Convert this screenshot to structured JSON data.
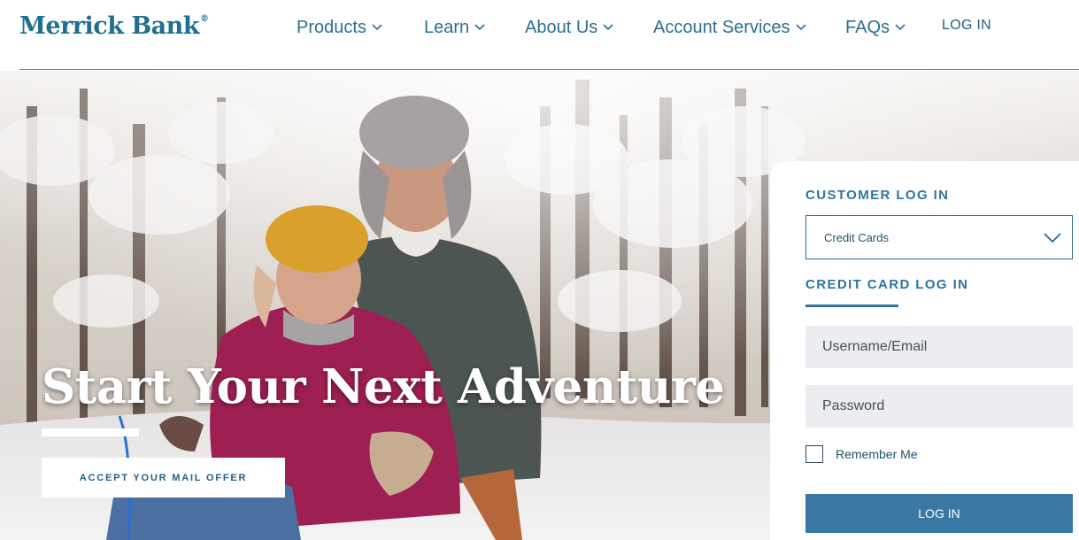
{
  "brand": {
    "name": "Merrick Bank",
    "registered_mark": "®",
    "color": "#1f6f8f"
  },
  "nav": {
    "items": [
      {
        "label": "Products",
        "icon": "chevron-down-icon"
      },
      {
        "label": "Learn",
        "icon": "chevron-down-icon"
      },
      {
        "label": "About Us",
        "icon": "chevron-down-icon"
      },
      {
        "label": "Account Services",
        "icon": "chevron-down-icon"
      },
      {
        "label": "FAQs",
        "icon": "chevron-down-icon"
      }
    ],
    "login_label": "LOG IN",
    "accent": "#2b6f93"
  },
  "hero": {
    "title": "Start Your Next Adventure",
    "offer_button_label": "ACCEPT YOUR MAIL OFFER"
  },
  "login_panel": {
    "heading": "CUSTOMER LOG IN",
    "account_type": {
      "selected": "Credit Cards",
      "icon": "chevron-down-icon"
    },
    "subheading": "CREDIT CARD LOG IN",
    "username_placeholder": "Username/Email",
    "password_placeholder": "Password",
    "remember_label": "Remember Me",
    "remember_checked": false,
    "submit_label": "LOG IN",
    "button_color": "#3a77a2"
  }
}
